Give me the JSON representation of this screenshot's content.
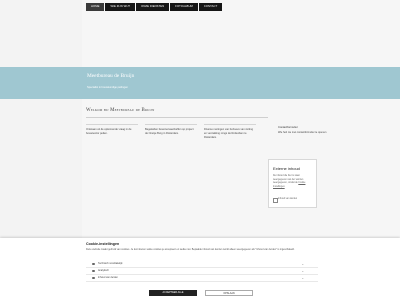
{
  "nav": {
    "items": [
      {
        "label": "HOME"
      },
      {
        "label": "WIE ZIJN WIJ?"
      },
      {
        "label": "ONZE DIENSTEN"
      },
      {
        "label": "FOTOALBUM"
      },
      {
        "label": "CONTACT"
      }
    ]
  },
  "hero": {
    "title": "Meetbureau de Bruijn",
    "subtitle": "Specialist in bouwkundige peilingen"
  },
  "main": {
    "welcome": "Welkom bij Meetbureau de Bruijn",
    "col1": "Ontstaan uit de opkomende vraag in de bouwsector peilen.",
    "col2": "Begeleiden bewonersaanheffen op project de Oranje Burg in Rotterdam.",
    "col3": "Diverse metingen van behoeve van zetting en verzakking rongs de Rotterdam te Rotterdam."
  },
  "sidebar": {
    "heading": "Contactformulier",
    "text": "Wie heb nie met contactformulier te openen",
    "card": {
      "heading": "Externe inhoud",
      "text_before": "De inhoud die hier is staat weergegeven van der worden weergegeven, omdat de",
      "link": "Cookie Instellingen",
      "text_after": ".",
      "checkbox_label": "Inhoud van derden"
    }
  },
  "cookie": {
    "heading": "Cookie-instellingen",
    "text": "Deze website maakt gebruik van cookies. Je kunt kiezen welke cookies je accepteert en welke niet. Bepaalde inhoud van derden wordt alleen weergegeven als \"Inhoud van derden\" is ingeschakeld.",
    "options": [
      {
        "label": "Technisch noodzakelijk"
      },
      {
        "label": "Analytisch"
      },
      {
        "label": "Inhoud van derden"
      }
    ],
    "accept_label": "ACCEPTEER ALLE",
    "save_label": "OPSLAAN"
  }
}
